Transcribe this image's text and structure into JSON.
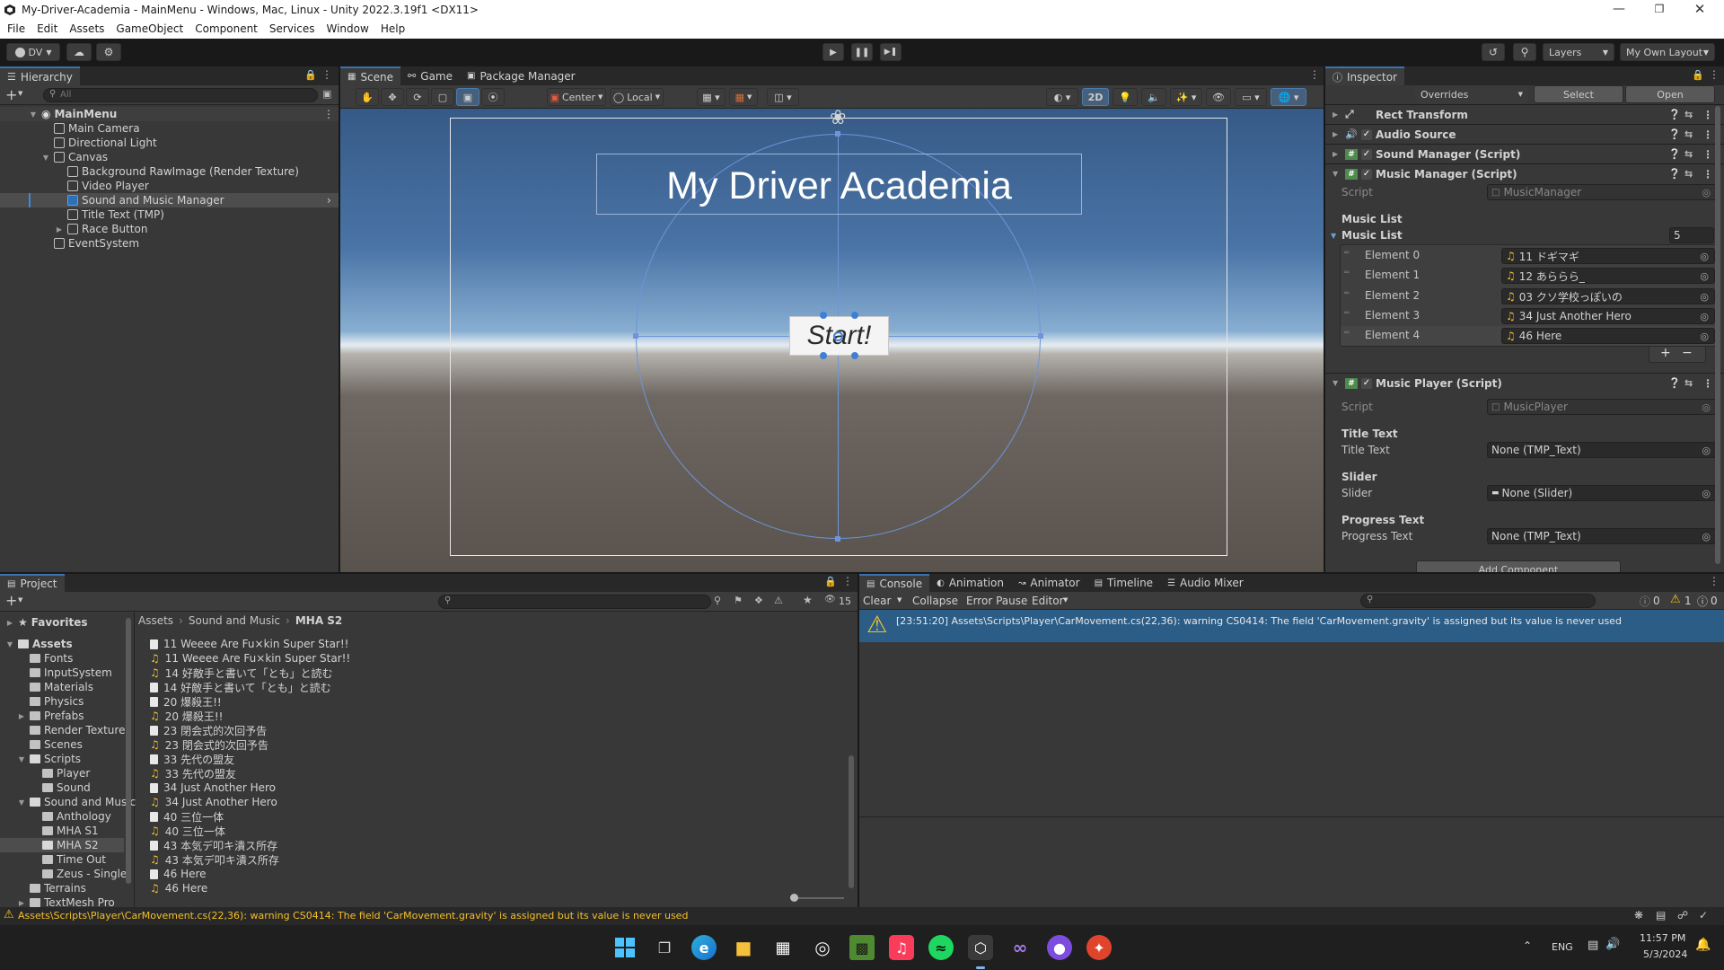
{
  "window": {
    "title": "My-Driver-Academia - MainMenu - Windows, Mac, Linux - Unity 2022.3.19f1 <DX11>"
  },
  "menu": [
    "File",
    "Edit",
    "Assets",
    "GameObject",
    "Component",
    "Services",
    "Window",
    "Help"
  ],
  "toolbar": {
    "account": "DV",
    "layers": "Layers",
    "layout": "My Own Layout"
  },
  "hierarchy": {
    "tab": "Hierarchy",
    "search_placeholder": "All",
    "items": [
      {
        "label": "MainMenu"
      },
      {
        "label": "Main Camera"
      },
      {
        "label": "Directional Light"
      },
      {
        "label": "Canvas"
      },
      {
        "label": "Background RawImage (Render Texture)"
      },
      {
        "label": "Video Player"
      },
      {
        "label": "Sound and Music Manager"
      },
      {
        "label": "Title Text (TMP)"
      },
      {
        "label": "Race Button"
      },
      {
        "label": "EventSystem"
      }
    ]
  },
  "scene": {
    "tabs": [
      "Scene",
      "Game",
      "Package Manager"
    ],
    "pivot": "Center",
    "space": "Local",
    "mode_2d": "2D",
    "title_text": "My Driver Academia",
    "button_text": "Start!"
  },
  "inspector": {
    "tab": "Inspector",
    "overrides": "Overrides",
    "select": "Select",
    "open": "Open",
    "components": [
      "Rect Transform",
      "Audio Source",
      "Sound Manager (Script)",
      "Music Manager (Script)",
      "Music Player (Script)"
    ],
    "music_manager": {
      "script_label": "Script",
      "script_value": "MusicManager",
      "header": "Music List",
      "list_label": "Music List",
      "count": "5",
      "elements": [
        {
          "label": "Element 0",
          "value": "11 ドギマギ"
        },
        {
          "label": "Element 1",
          "value": "12 あららら_"
        },
        {
          "label": "Element 2",
          "value": "03 クソ学校っぽいの"
        },
        {
          "label": "Element 3",
          "value": "34 Just Another Hero"
        },
        {
          "label": "Element 4",
          "value": "46 Here"
        }
      ]
    },
    "music_player": {
      "script_label": "Script",
      "script_value": "MusicPlayer",
      "title_header": "Title Text",
      "title_label": "Title Text",
      "title_value": "None (TMP_Text)",
      "slider_header": "Slider",
      "slider_label": "Slider",
      "slider_value": "None (Slider)",
      "progress_header": "Progress Text",
      "progress_label": "Progress Text",
      "progress_value": "None (TMP_Text)"
    },
    "add_component": "Add Component"
  },
  "project": {
    "tab": "Project",
    "favorites": "Favorites",
    "assets": "Assets",
    "breadcrumb": [
      "Assets",
      "Sound and Music",
      "MHA S2"
    ],
    "hidden_count": "15",
    "tree": [
      "Fonts",
      "InputSystem",
      "Materials",
      "Physics",
      "Prefabs",
      "Render Textures",
      "Scenes",
      "Scripts",
      "Player",
      "Sound",
      "Sound and Music",
      "Anthology",
      "MHA S1",
      "MHA S2",
      "Time Out",
      "Zeus - Single",
      "Terrains",
      "TextMesh Pro"
    ],
    "files": [
      {
        "name": "11 Weeee Are Fu×kin Super Star!!",
        "kind": "doc"
      },
      {
        "name": "11 Weeee Are Fu×kin Super Star!!",
        "kind": "audio"
      },
      {
        "name": "14 好敵手と書いて「とも」と読む",
        "kind": "audio"
      },
      {
        "name": "14 好敵手と書いて「とも」と読む",
        "kind": "doc"
      },
      {
        "name": "20 爆殺王!!",
        "kind": "doc"
      },
      {
        "name": "20 爆殺王!!",
        "kind": "audio"
      },
      {
        "name": "23 閉会式的次回予告",
        "kind": "doc"
      },
      {
        "name": "23 閉会式的次回予告",
        "kind": "audio"
      },
      {
        "name": "33 先代の盟友",
        "kind": "doc"
      },
      {
        "name": "33 先代の盟友",
        "kind": "audio"
      },
      {
        "name": "34 Just Another Hero",
        "kind": "doc"
      },
      {
        "name": "34 Just Another Hero",
        "kind": "audio"
      },
      {
        "name": "40 三位一体",
        "kind": "doc"
      },
      {
        "name": "40 三位一体",
        "kind": "audio"
      },
      {
        "name": "43 本気デ叩キ潰ス所存",
        "kind": "doc"
      },
      {
        "name": "43 本気デ叩キ潰ス所存",
        "kind": "audio"
      },
      {
        "name": "46 Here",
        "kind": "doc"
      },
      {
        "name": "46 Here",
        "kind": "audio"
      }
    ]
  },
  "console": {
    "tabs": [
      "Console",
      "Animation",
      "Animator",
      "Timeline",
      "Audio Mixer"
    ],
    "clear": "Clear",
    "collapse": "Collapse",
    "error_pause": "Error Pause",
    "editor": "Editor",
    "count_log": "0",
    "count_warn": "1",
    "count_err": "0",
    "message": "[23:51:20] Assets\\Scripts\\Player\\CarMovement.cs(22,36): warning CS0414: The field 'CarMovement.gravity' is assigned but its value is never used"
  },
  "status_bar": {
    "message": "Assets\\Scripts\\Player\\CarMovement.cs(22,36): warning CS0414: The field 'CarMovement.gravity' is assigned but its value is never used"
  },
  "taskbar": {
    "lang": "ENG",
    "time": "11:57 PM",
    "date": "5/3/2024"
  }
}
